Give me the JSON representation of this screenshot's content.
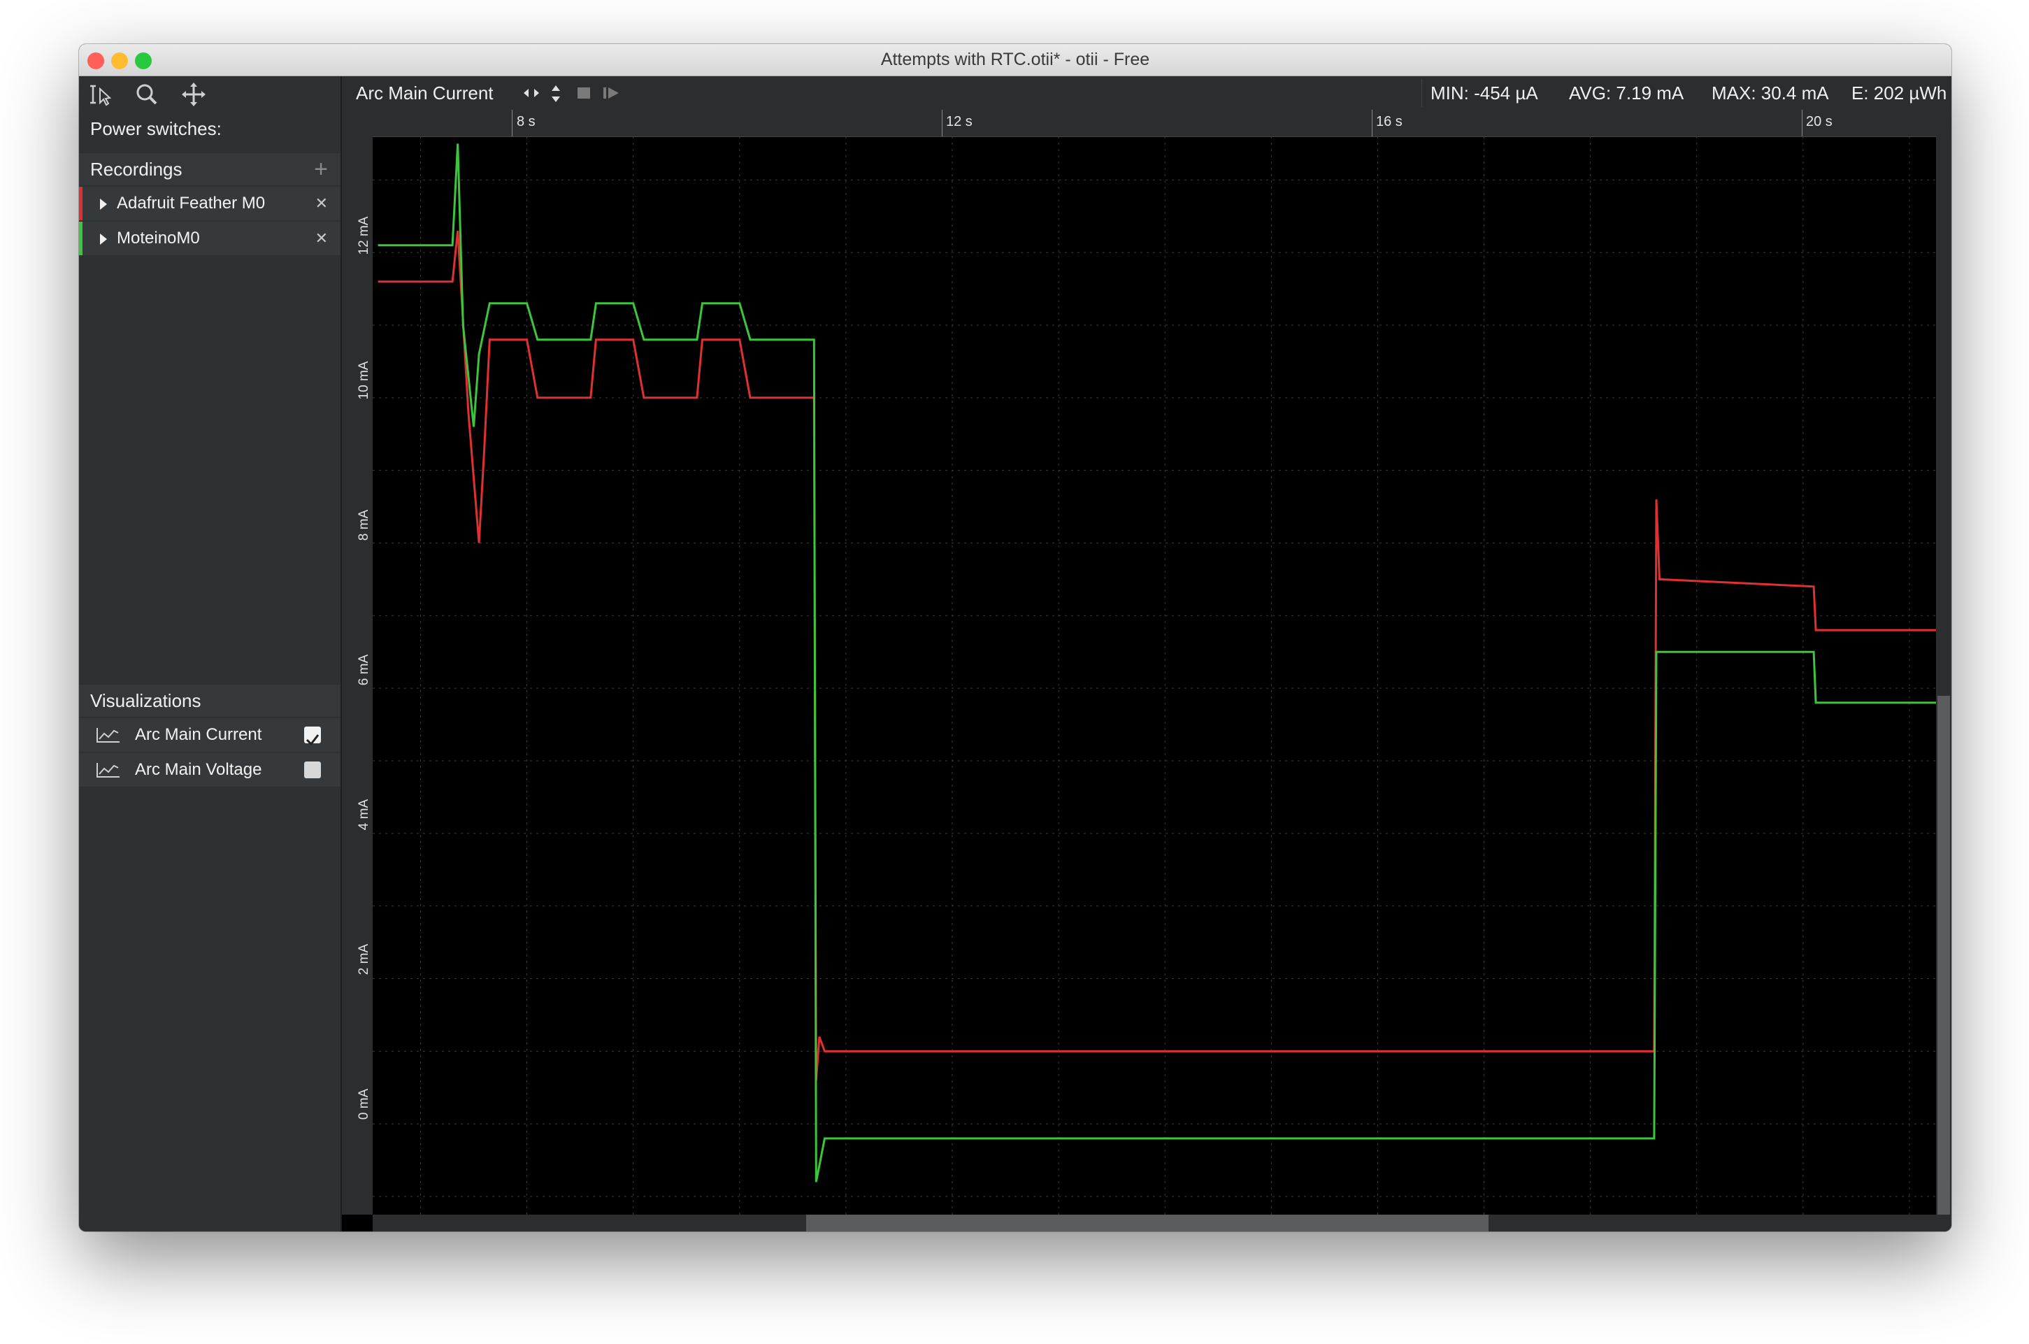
{
  "window": {
    "title": "Attempts with RTC.otii* - otii - Free"
  },
  "sidebar": {
    "power_switches_label": "Power switches:",
    "recordings_label": "Recordings",
    "recordings": [
      {
        "name": "Adafruit Feather M0",
        "color": "#e03030"
      },
      {
        "name": "MoteinoM0",
        "color": "#3cc63c"
      }
    ],
    "visualizations_label": "Visualizations",
    "visualizations": [
      {
        "name": "Arc Main Current",
        "checked": true
      },
      {
        "name": "Arc Main Voltage",
        "checked": false
      }
    ]
  },
  "toolbar": {
    "channel_label": "Arc Main Current",
    "stats": {
      "min": "MIN: -454 µA",
      "avg": "AVG: 7.19 mA",
      "max": "MAX: 30.4 mA",
      "energy": "E: 202 µWh"
    }
  },
  "time_ruler": {
    "labels": [
      "8 s",
      "12 s",
      "16 s",
      "20 s"
    ]
  },
  "y_axis": {
    "labels": [
      "12 mA",
      "10 mA",
      "8 mA",
      "6 mA",
      "4 mA",
      "2 mA",
      "0 mA"
    ]
  },
  "chart_data": {
    "type": "line",
    "xlabel": "",
    "ylabel": "",
    "xlim": [
      6.55,
      21.25
    ],
    "ylim": [
      -1.25,
      13.6
    ],
    "series": [
      {
        "name": "Adafruit Feather M0",
        "color": "#e03030",
        "points": [
          [
            6.6,
            11.6
          ],
          [
            7.3,
            11.6
          ],
          [
            7.35,
            12.3
          ],
          [
            7.45,
            9.8
          ],
          [
            7.55,
            8.0
          ],
          [
            7.6,
            9.3
          ],
          [
            7.65,
            10.8
          ],
          [
            8.0,
            10.8
          ],
          [
            8.1,
            10.0
          ],
          [
            8.6,
            10.0
          ],
          [
            8.65,
            10.8
          ],
          [
            9.0,
            10.8
          ],
          [
            9.1,
            10.0
          ],
          [
            9.6,
            10.0
          ],
          [
            9.65,
            10.8
          ],
          [
            10.0,
            10.8
          ],
          [
            10.1,
            10.0
          ],
          [
            10.7,
            10.0
          ],
          [
            10.72,
            0.6
          ],
          [
            10.75,
            1.2
          ],
          [
            10.8,
            1.0
          ],
          [
            18.6,
            1.0
          ],
          [
            18.62,
            8.6
          ],
          [
            18.65,
            7.5
          ],
          [
            20.1,
            7.4
          ],
          [
            20.12,
            6.8
          ],
          [
            21.25,
            6.8
          ]
        ]
      },
      {
        "name": "MoteinoM0",
        "color": "#3cc63c",
        "points": [
          [
            6.6,
            12.1
          ],
          [
            7.3,
            12.1
          ],
          [
            7.35,
            13.5
          ],
          [
            7.4,
            11.0
          ],
          [
            7.5,
            9.6
          ],
          [
            7.55,
            10.6
          ],
          [
            7.65,
            11.3
          ],
          [
            8.0,
            11.3
          ],
          [
            8.1,
            10.8
          ],
          [
            8.6,
            10.8
          ],
          [
            8.65,
            11.3
          ],
          [
            9.0,
            11.3
          ],
          [
            9.1,
            10.8
          ],
          [
            9.6,
            10.8
          ],
          [
            9.65,
            11.3
          ],
          [
            10.0,
            11.3
          ],
          [
            10.1,
            10.8
          ],
          [
            10.7,
            10.8
          ],
          [
            10.72,
            -0.8
          ],
          [
            10.8,
            -0.2
          ],
          [
            10.9,
            -0.2
          ],
          [
            18.6,
            -0.2
          ],
          [
            18.62,
            6.5
          ],
          [
            18.7,
            6.5
          ],
          [
            20.1,
            6.5
          ],
          [
            20.12,
            5.8
          ],
          [
            21.25,
            5.8
          ]
        ]
      }
    ]
  }
}
